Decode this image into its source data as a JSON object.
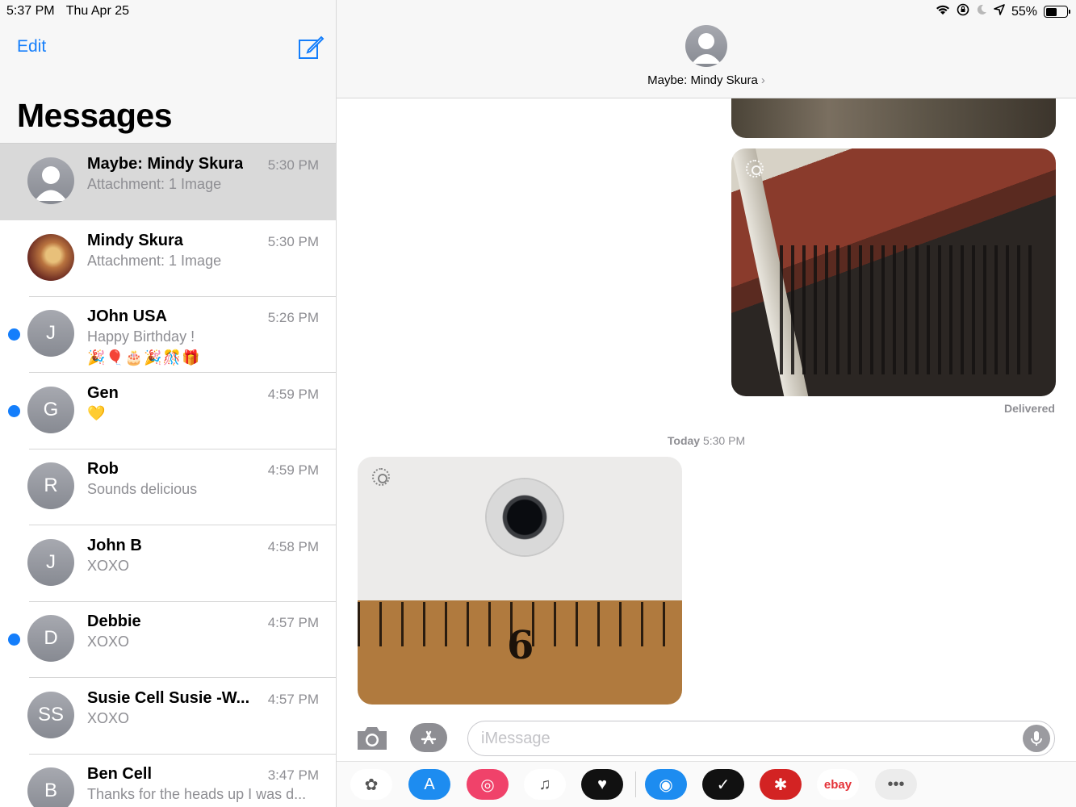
{
  "status_bar": {
    "time": "5:37 PM",
    "date": "Thu Apr 25",
    "battery": "55%",
    "battery_level": 0.55,
    "icons": [
      "wifi-icon",
      "orientation-lock-icon",
      "moon-icon",
      "location-icon"
    ]
  },
  "sidebar": {
    "edit_label": "Edit",
    "compose_icon": "compose-icon",
    "title": "Messages",
    "conversations": [
      {
        "name": "Maybe: Mindy Skura",
        "time": "5:30 PM",
        "preview": "Attachment: 1 Image",
        "initials": "",
        "unread": false,
        "selected": true
      },
      {
        "name": "Mindy Skura",
        "time": "5:30 PM",
        "preview": "Attachment: 1 Image",
        "initials": "",
        "unread": false,
        "photo": true
      },
      {
        "name": "JOhn USA",
        "time": "5:26 PM",
        "preview": "Happy Birthday !",
        "emoji": "🎉🎈🎂🎉🎊🎁",
        "initials": "J",
        "unread": true
      },
      {
        "name": "Gen",
        "time": "4:59 PM",
        "preview": "💛",
        "initials": "G",
        "unread": true
      },
      {
        "name": "Rob",
        "time": "4:59 PM",
        "preview": "Sounds delicious",
        "initials": "R",
        "unread": false
      },
      {
        "name": "John B",
        "time": "4:58 PM",
        "preview": "XOXO",
        "initials": "J",
        "unread": false
      },
      {
        "name": "Debbie",
        "time": "4:57 PM",
        "preview": "XOXO",
        "initials": "D",
        "unread": true
      },
      {
        "name": "Susie Cell Susie -W...",
        "time": "4:57 PM",
        "preview": "XOXO",
        "initials": "SS",
        "unread": false
      },
      {
        "name": "Ben Cell",
        "time": "3:47 PM",
        "preview": "Thanks for the heads up I was d...",
        "initials": "B",
        "unread": false
      }
    ]
  },
  "conversation": {
    "contact_name": "Maybe: Mindy Skura",
    "delivered_label": "Delivered",
    "timestamp_day": "Today",
    "timestamp_time": "5:30 PM"
  },
  "composer": {
    "placeholder": "iMessage",
    "camera_icon": "camera-icon",
    "appstore_icon": "app-store-icon",
    "mic_icon": "microphone-icon"
  },
  "app_drawer": {
    "apps": [
      {
        "name": "photos-app-icon",
        "glyph": "✿",
        "color": "#ffffff"
      },
      {
        "name": "app-store-app-icon",
        "glyph": "A",
        "color": "#1d8cf0"
      },
      {
        "name": "search-images-app-icon",
        "glyph": "◎",
        "color": "#f0426a"
      },
      {
        "name": "music-app-icon",
        "glyph": "♫",
        "color": "#ffffff"
      },
      {
        "name": "digital-touch-app-icon",
        "glyph": "♥",
        "color": "#111111"
      },
      {
        "name": "eye-app-icon",
        "glyph": "◉",
        "color": "#1d8cf0"
      },
      {
        "name": "verizon-app-icon",
        "glyph": "✓",
        "color": "#111111"
      },
      {
        "name": "yelp-app-icon",
        "glyph": "✱",
        "color": "#d32323"
      },
      {
        "name": "ebay-app-icon",
        "glyph": "ebay",
        "color": "#ffffff"
      },
      {
        "name": "more-apps-icon",
        "glyph": "•••",
        "color": "#ececec"
      }
    ]
  }
}
